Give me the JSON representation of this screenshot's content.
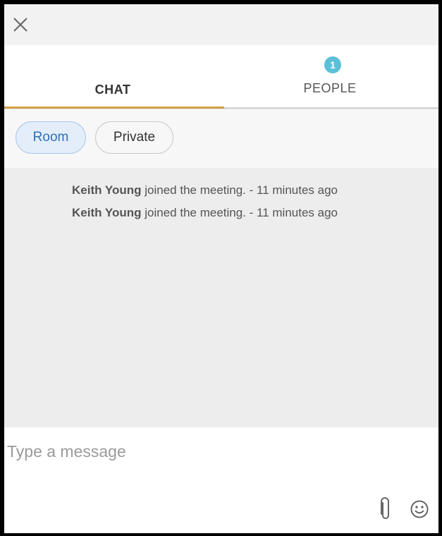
{
  "header": {
    "close_icon": "close-icon"
  },
  "tabs": [
    {
      "label": "CHAT",
      "active": true
    },
    {
      "label": "PEOPLE",
      "active": false,
      "badge": "1"
    }
  ],
  "filters": [
    {
      "label": "Room",
      "selected": true
    },
    {
      "label": "Private",
      "selected": false
    }
  ],
  "log": [
    {
      "name": "Keith Young",
      "text": " joined the meeting. - 11 minutes ago"
    },
    {
      "name": "Keith Young",
      "text": " joined the meeting. - 11 minutes ago"
    }
  ],
  "composer": {
    "placeholder": "Type a message",
    "value": "",
    "attach_icon": "paperclip-icon",
    "emoji_icon": "smiley-icon"
  },
  "colors": {
    "accent_underline": "#d4a24a",
    "badge": "#5bc0d8",
    "room_pill_text": "#2f6fb8"
  }
}
